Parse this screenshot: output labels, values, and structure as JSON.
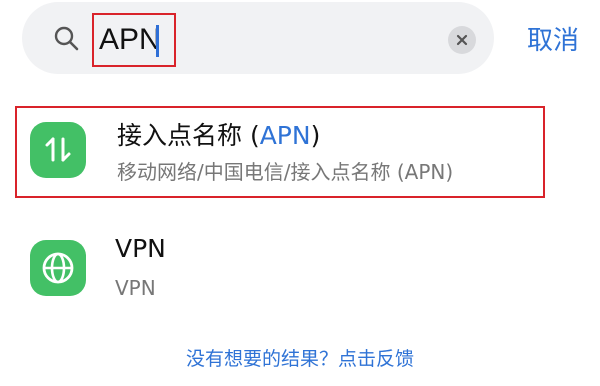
{
  "search": {
    "query": "APN",
    "cancel_label": "取消"
  },
  "results": [
    {
      "title_prefix": "接入点名称 (",
      "title_highlight": "APN",
      "title_suffix": ")",
      "path": "移动网络/中国电信/接入点名称 (APN)",
      "icon": "data-transfer-icon"
    },
    {
      "title": "VPN",
      "path": "VPN",
      "icon": "globe-icon"
    }
  ],
  "feedback_label": "没有想要的结果？点击反馈",
  "colors": {
    "accent": "#2f73d6",
    "icon_green": "#43c066",
    "highlight_border": "#d9232a"
  }
}
